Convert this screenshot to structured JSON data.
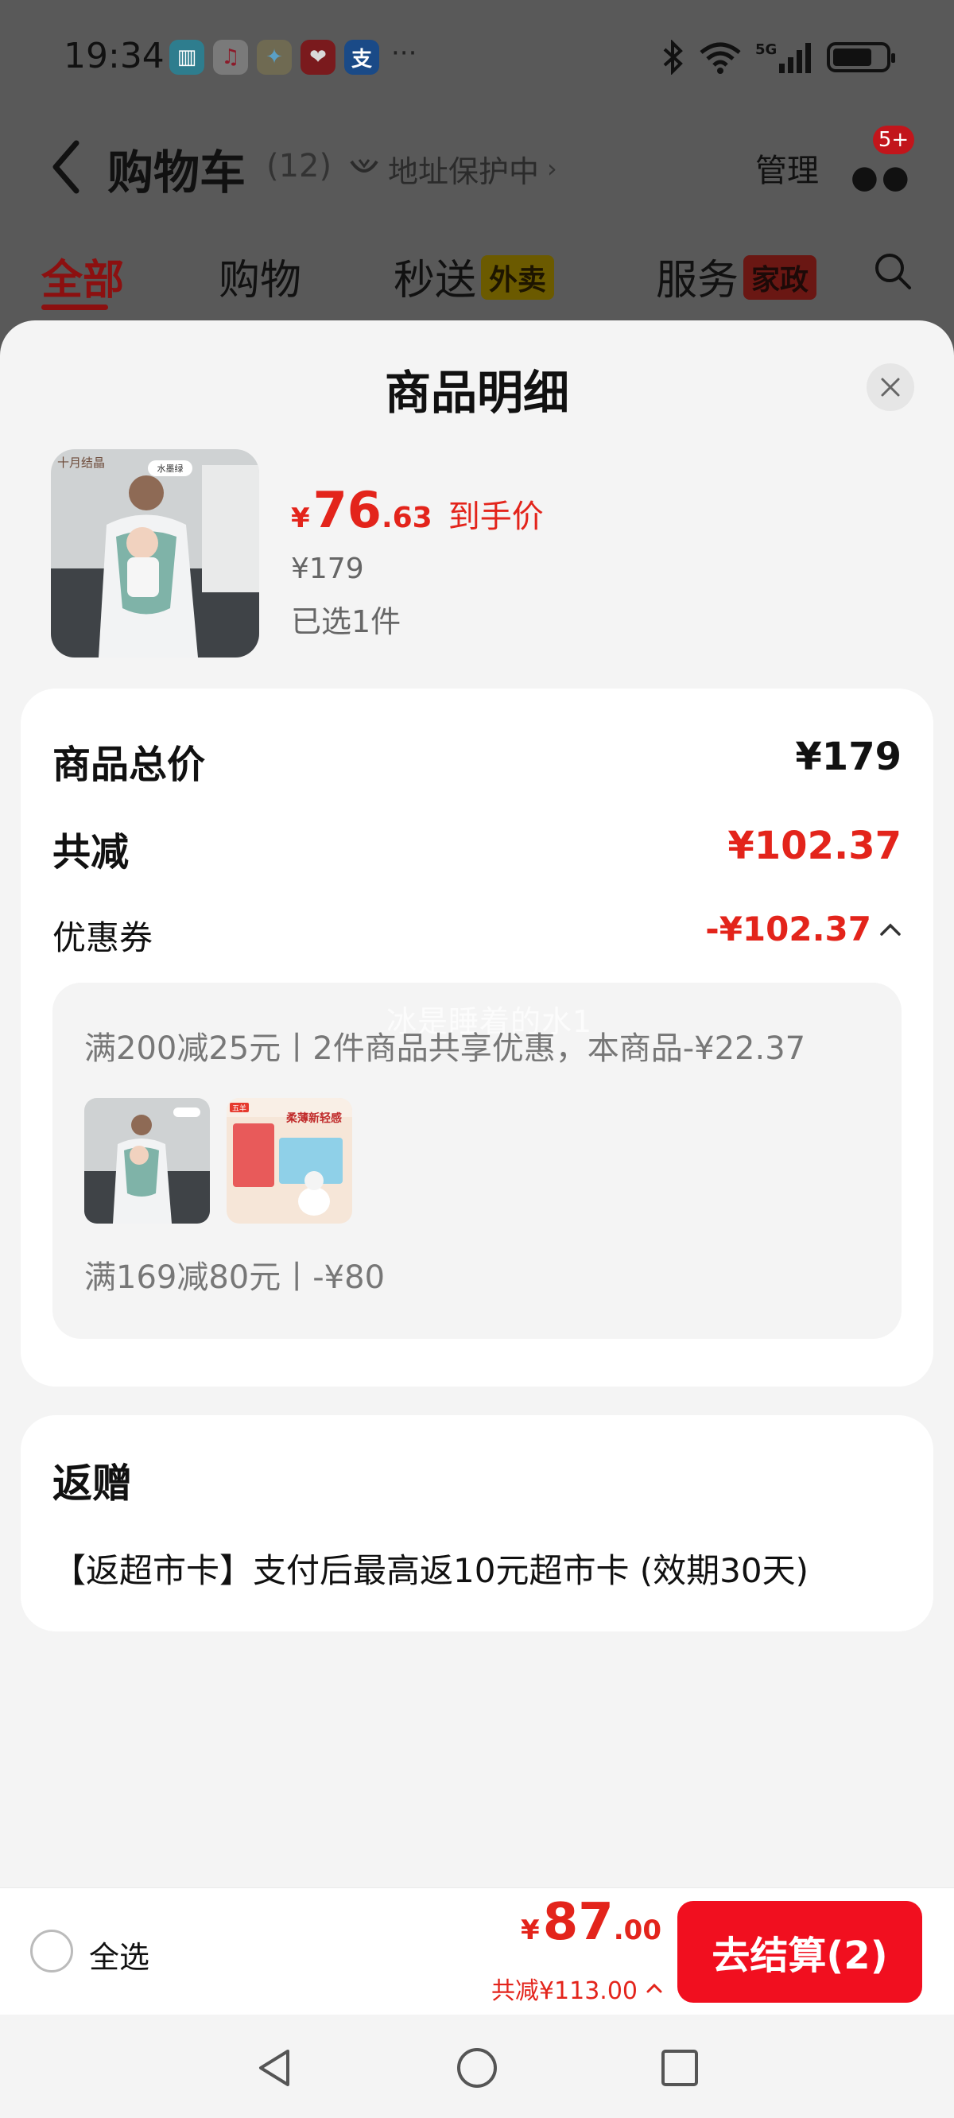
{
  "status_bar": {
    "time": "19:34",
    "apps": [
      {
        "icon": "books-app-icon",
        "glyph": "▥",
        "color": "#3cb4cf"
      },
      {
        "icon": "music-app-icon",
        "glyph": "♫",
        "color": "#ffffff"
      },
      {
        "icon": "pinwheel-app-icon",
        "glyph": "✦",
        "color": "#f6b723"
      },
      {
        "icon": "health-app-icon",
        "glyph": "❤",
        "color": "#e0262d"
      },
      {
        "icon": "alipay-app-icon",
        "glyph": "支",
        "color": "#1677ff"
      }
    ],
    "more": "···",
    "network": "5G"
  },
  "header": {
    "title": "购物车",
    "count": "(12)",
    "address": "地址保护中",
    "manage": "管理",
    "badge": "5+"
  },
  "tabs": [
    {
      "label": "全部",
      "tag": ""
    },
    {
      "label": "购物",
      "tag": ""
    },
    {
      "label": "秒送",
      "tag": "外卖"
    },
    {
      "label": "服务",
      "tag": "家政"
    }
  ],
  "sheet": {
    "title": "商品明细",
    "product": {
      "price_symbol": "¥",
      "price_int": "76",
      "price_dec": ".63",
      "price_tag": "到手价",
      "original_price": "¥179",
      "selected": "已选1件",
      "thumb_brand": "十月结晶",
      "thumb_color": "水墨绿"
    },
    "total": {
      "label": "商品总价",
      "value": "¥179"
    },
    "discount": {
      "label": "共减",
      "value": "¥102.37"
    },
    "coupon": {
      "label": "优惠券",
      "value": "-¥102.37",
      "line1": "满200减25元丨2件商品共享优惠，本商品-¥22.37",
      "line2": "满169减80元丨-¥80",
      "thumb2_brand": "五羊",
      "thumb2_text": "柔薄新轻感",
      "watermark": "冰是睡着的水1"
    },
    "gift": {
      "title": "返赠",
      "text": "【返超市卡】支付后最高返10元超市卡 (效期30天)"
    }
  },
  "checkout": {
    "select_all": "全选",
    "total_symbol": "¥",
    "total_int": "87",
    "total_dec": ".00",
    "saved": "共减¥113.00",
    "button": "去结算(2)"
  },
  "colors": {
    "accent_red": "#e3241b",
    "button_red": "#f10f1f",
    "sheet_bg": "#f4f4f4",
    "overlay": "#595959"
  }
}
